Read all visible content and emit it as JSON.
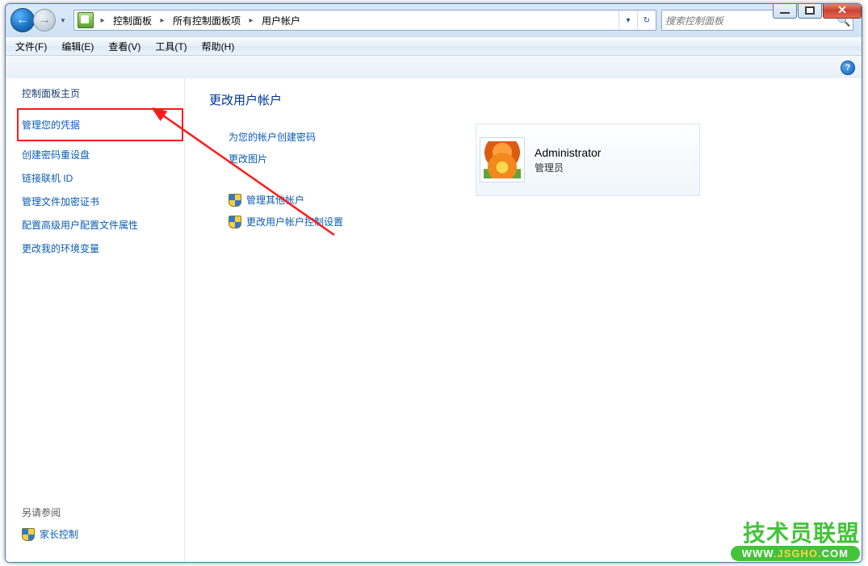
{
  "titlebar": {
    "close_glyph": "✕"
  },
  "nav": {
    "back_glyph": "←",
    "forward_glyph": "→",
    "dropdown_glyph": "▼"
  },
  "address": {
    "crumbs": [
      "控制面板",
      "所有控制面板项",
      "用户帐户"
    ],
    "arrow_glyph": "▸",
    "dropdown_glyph": "▾",
    "refresh_glyph": "↻"
  },
  "search": {
    "placeholder": "搜索控制面板",
    "icon_glyph": "🔍"
  },
  "menubar": {
    "items": [
      "文件(F)",
      "编辑(E)",
      "查看(V)",
      "工具(T)",
      "帮助(H)"
    ]
  },
  "toolbar": {
    "help_glyph": "?"
  },
  "sidebar": {
    "heading": "控制面板主页",
    "links": {
      "credentials": "管理您的凭据",
      "reset_disk": "创建密码重设盘",
      "link_online": "链接联机 ID",
      "efs_certs": "管理文件加密证书",
      "adv_profile": "配置高级用户配置文件属性",
      "env_vars": "更改我的环境变量"
    },
    "also_label": "另请参阅",
    "parental": "家长控制"
  },
  "content": {
    "title": "更改用户帐户",
    "actions": {
      "create_password": "为您的帐户创建密码",
      "change_picture": "更改图片",
      "manage_other": "管理其他帐户",
      "uac_settings": "更改用户帐户控制设置"
    }
  },
  "account": {
    "name": "Administrator",
    "role": "管理员"
  },
  "watermark": {
    "main": "技术员联盟",
    "url_prefix": "WWW",
    "url_mid": "JSGHO",
    "url_suffix": "COM"
  }
}
